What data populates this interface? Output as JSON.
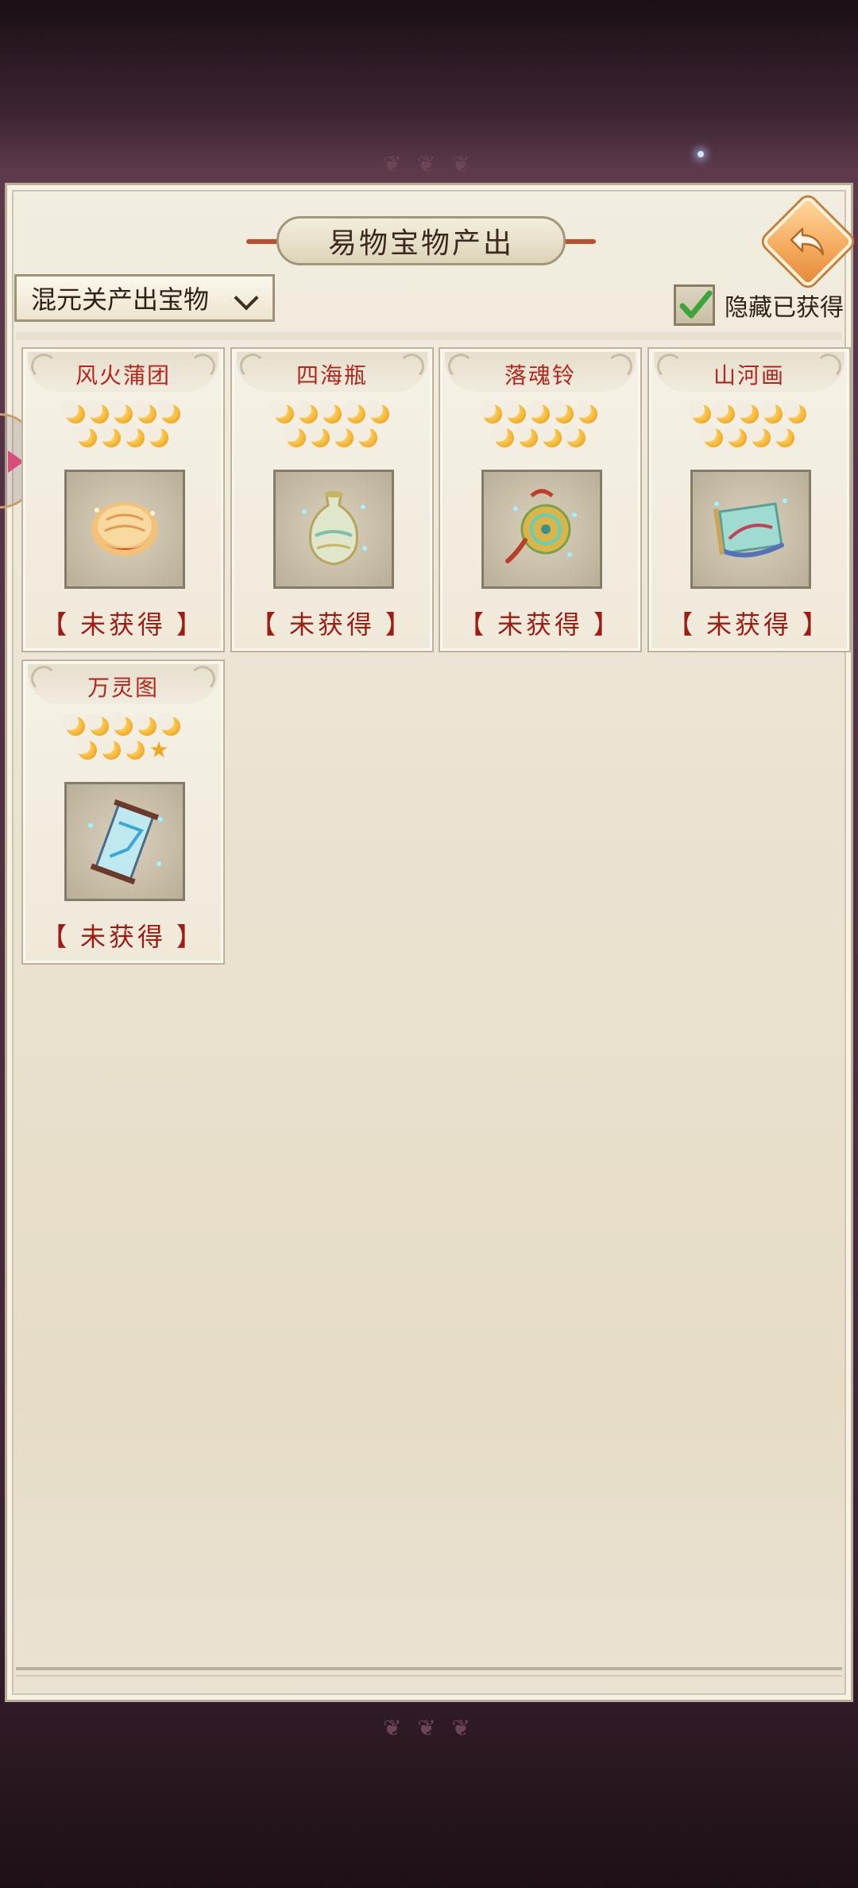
{
  "window": {
    "title": "易物宝物产出",
    "back_label": "back"
  },
  "filter": {
    "selected": "混元关产出宝物"
  },
  "hide_obtained": {
    "label": "隐藏已获得",
    "checked": true
  },
  "treasures": [
    {
      "name": "风火蒲团",
      "rating": [
        "moon",
        "moon",
        "moon",
        "moon",
        "moon",
        "moon",
        "moon",
        "moon",
        "moon"
      ],
      "status": "【 未获得 】",
      "icon": "cushion-icon"
    },
    {
      "name": "四海瓶",
      "rating": [
        "moon",
        "moon",
        "moon",
        "moon",
        "moon",
        "moon",
        "moon",
        "moon",
        "moon"
      ],
      "status": "【 未获得 】",
      "icon": "vase-icon"
    },
    {
      "name": "落魂铃",
      "rating": [
        "moon",
        "moon",
        "moon",
        "moon",
        "moon",
        "moon",
        "moon",
        "moon",
        "moon"
      ],
      "status": "【 未获得 】",
      "icon": "bell-icon"
    },
    {
      "name": "山河画",
      "rating": [
        "moon",
        "moon",
        "moon",
        "moon",
        "moon",
        "moon",
        "moon",
        "moon",
        "moon"
      ],
      "status": "【 未获得 】",
      "icon": "scroll-painting-icon"
    },
    {
      "name": "万灵图",
      "rating": [
        "moon",
        "moon",
        "moon",
        "moon",
        "moon",
        "moon",
        "moon",
        "moon",
        "star"
      ],
      "status": "【 未获得 】",
      "icon": "hanging-scroll-icon"
    }
  ],
  "colors": {
    "name_red": "#b3271e",
    "status_red": "#9e1c14",
    "accent_orange": "#f4a85a",
    "check_green": "#3aa538"
  }
}
